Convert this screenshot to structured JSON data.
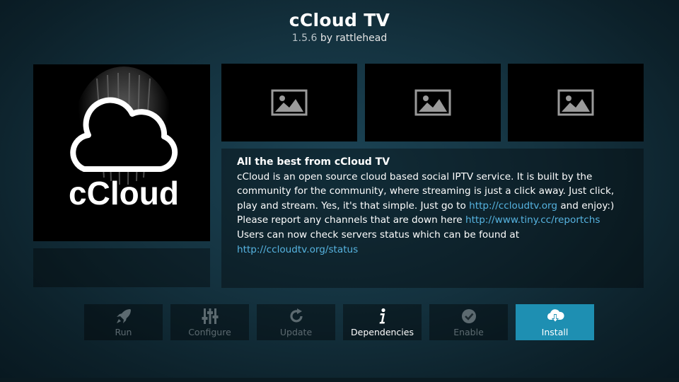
{
  "header": {
    "title": "cCloud TV",
    "version": "1.5.6",
    "author": "by rattlehead"
  },
  "poster": {
    "logo_text": "cCloud",
    "icon": "cloud-logo-icon"
  },
  "screenshots": [
    {
      "icon": "image-placeholder-icon"
    },
    {
      "icon": "image-placeholder-icon"
    },
    {
      "icon": "image-placeholder-icon"
    }
  ],
  "description": {
    "title": "All the best from cCloud TV",
    "line1": "cCloud is an open source cloud based social IPTV service. It is built by the",
    "line2": "community for the community, where streaming is just a click away. Just click,",
    "line3_pre": "play and stream. Yes, it's that simple. Just go to ",
    "line3_link": "http://ccloudtv.org",
    "line3_post": " and enjoy:)",
    "line4_pre": "Please report any channels that are down here ",
    "line4_link": "http://www.tiny.cc/reportchs",
    "line5": "Users can now check servers status which can be found at",
    "line6_link": "http://ccloudtv.org/status"
  },
  "buttons": {
    "run": "Run",
    "configure": "Configure",
    "update": "Update",
    "dependencies": "Dependencies",
    "enable": "Enable",
    "install": "Install"
  },
  "colors": {
    "accent": "#1e8fb2",
    "link": "#56b3e0",
    "disabled_text": "#5c6a70"
  }
}
